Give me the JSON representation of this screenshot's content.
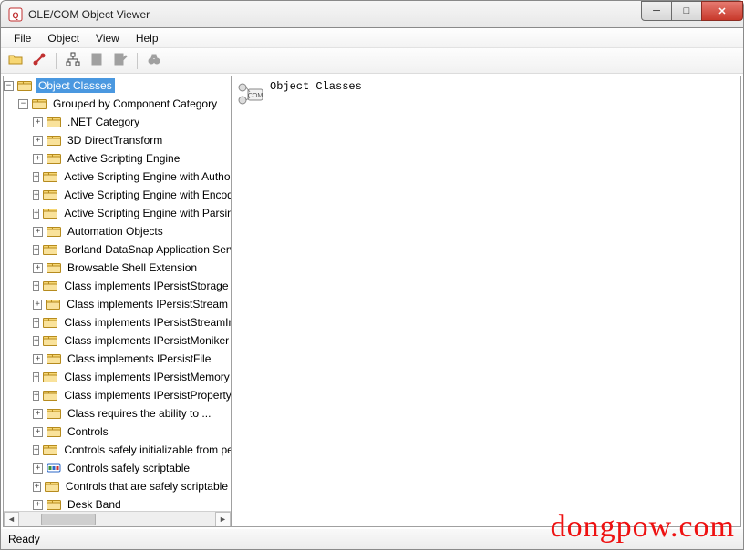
{
  "window": {
    "title": "OLE/COM Object Viewer"
  },
  "menubar": {
    "items": [
      "File",
      "Object",
      "View",
      "Help"
    ]
  },
  "statusbar": {
    "text": "Ready"
  },
  "watermark": "dongpow.com",
  "right": {
    "title": "Object Classes"
  },
  "tree": {
    "root": {
      "label": "Object Classes",
      "expanded": true
    },
    "group": {
      "label": "Grouped by Component Category",
      "expanded": true
    },
    "items": [
      {
        "label": ".NET Category",
        "icon": "folder"
      },
      {
        "label": "3D DirectTransform",
        "icon": "folder"
      },
      {
        "label": "Active Scripting Engine",
        "icon": "folder"
      },
      {
        "label": "Active Scripting Engine with Authoring",
        "icon": "folder"
      },
      {
        "label": "Active Scripting Engine with Encoding",
        "icon": "folder"
      },
      {
        "label": "Active Scripting Engine with Parsing",
        "icon": "folder"
      },
      {
        "label": "Automation Objects",
        "icon": "folder"
      },
      {
        "label": "Borland DataSnap Application Servers",
        "icon": "folder"
      },
      {
        "label": "Browsable Shell Extension",
        "icon": "folder"
      },
      {
        "label": "Class implements IPersistStorage",
        "icon": "folder"
      },
      {
        "label": "Class implements IPersistStream",
        "icon": "folder"
      },
      {
        "label": "Class implements IPersistStreamInit",
        "icon": "folder"
      },
      {
        "label": "Class implements IPersistMoniker",
        "icon": "folder"
      },
      {
        "label": "Class implements IPersistFile",
        "icon": "folder"
      },
      {
        "label": "Class implements IPersistMemory",
        "icon": "folder"
      },
      {
        "label": "Class implements IPersistPropertyBag",
        "icon": "folder"
      },
      {
        "label": "Class requires the ability to ...",
        "icon": "folder"
      },
      {
        "label": "Controls",
        "icon": "folder"
      },
      {
        "label": "Controls safely initializable from persistent data",
        "icon": "folder"
      },
      {
        "label": "Controls safely scriptable",
        "icon": "badge"
      },
      {
        "label": "Controls that are safely scriptable",
        "icon": "folder"
      },
      {
        "label": "Desk Band",
        "icon": "folder"
      }
    ]
  }
}
